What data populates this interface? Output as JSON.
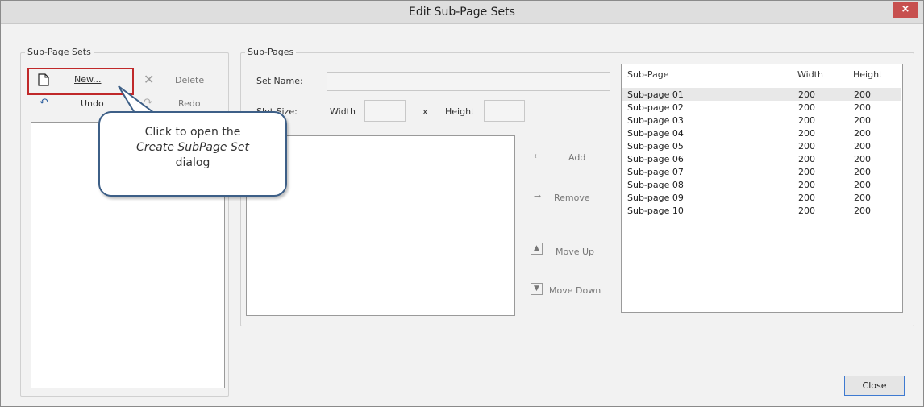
{
  "window": {
    "title": "Edit Sub-Page Sets",
    "close_glyph": "×"
  },
  "left_group": {
    "label": "Sub-Page Sets",
    "new_label": "New...",
    "delete_label": "Delete",
    "undo_label": "Undo",
    "redo_label": "Redo"
  },
  "callout": {
    "line1": "Click to open the",
    "line2": "Create SubPage Set",
    "line3": "dialog"
  },
  "right_group": {
    "label": "Sub-Pages",
    "set_name_label": "Set Name:",
    "slot_size_label": "Slot Size:",
    "width_label": "Width",
    "x_label": "x",
    "height_label": "Height",
    "add_label": "Add",
    "remove_label": "Remove",
    "move_up_label": "Move Up",
    "move_down_label": "Move Down"
  },
  "table": {
    "headers": [
      "Sub-Page",
      "Width",
      "Height"
    ],
    "rows": [
      [
        "Sub-page 01",
        "200",
        "200"
      ],
      [
        "Sub-page 02",
        "200",
        "200"
      ],
      [
        "Sub-page 03",
        "200",
        "200"
      ],
      [
        "Sub-page 04",
        "200",
        "200"
      ],
      [
        "Sub-page 05",
        "200",
        "200"
      ],
      [
        "Sub-page 06",
        "200",
        "200"
      ],
      [
        "Sub-page 07",
        "200",
        "200"
      ],
      [
        "Sub-page 08",
        "200",
        "200"
      ],
      [
        "Sub-page 09",
        "200",
        "200"
      ],
      [
        "Sub-page 10",
        "200",
        "200"
      ]
    ]
  },
  "footer": {
    "close_label": "Close"
  }
}
